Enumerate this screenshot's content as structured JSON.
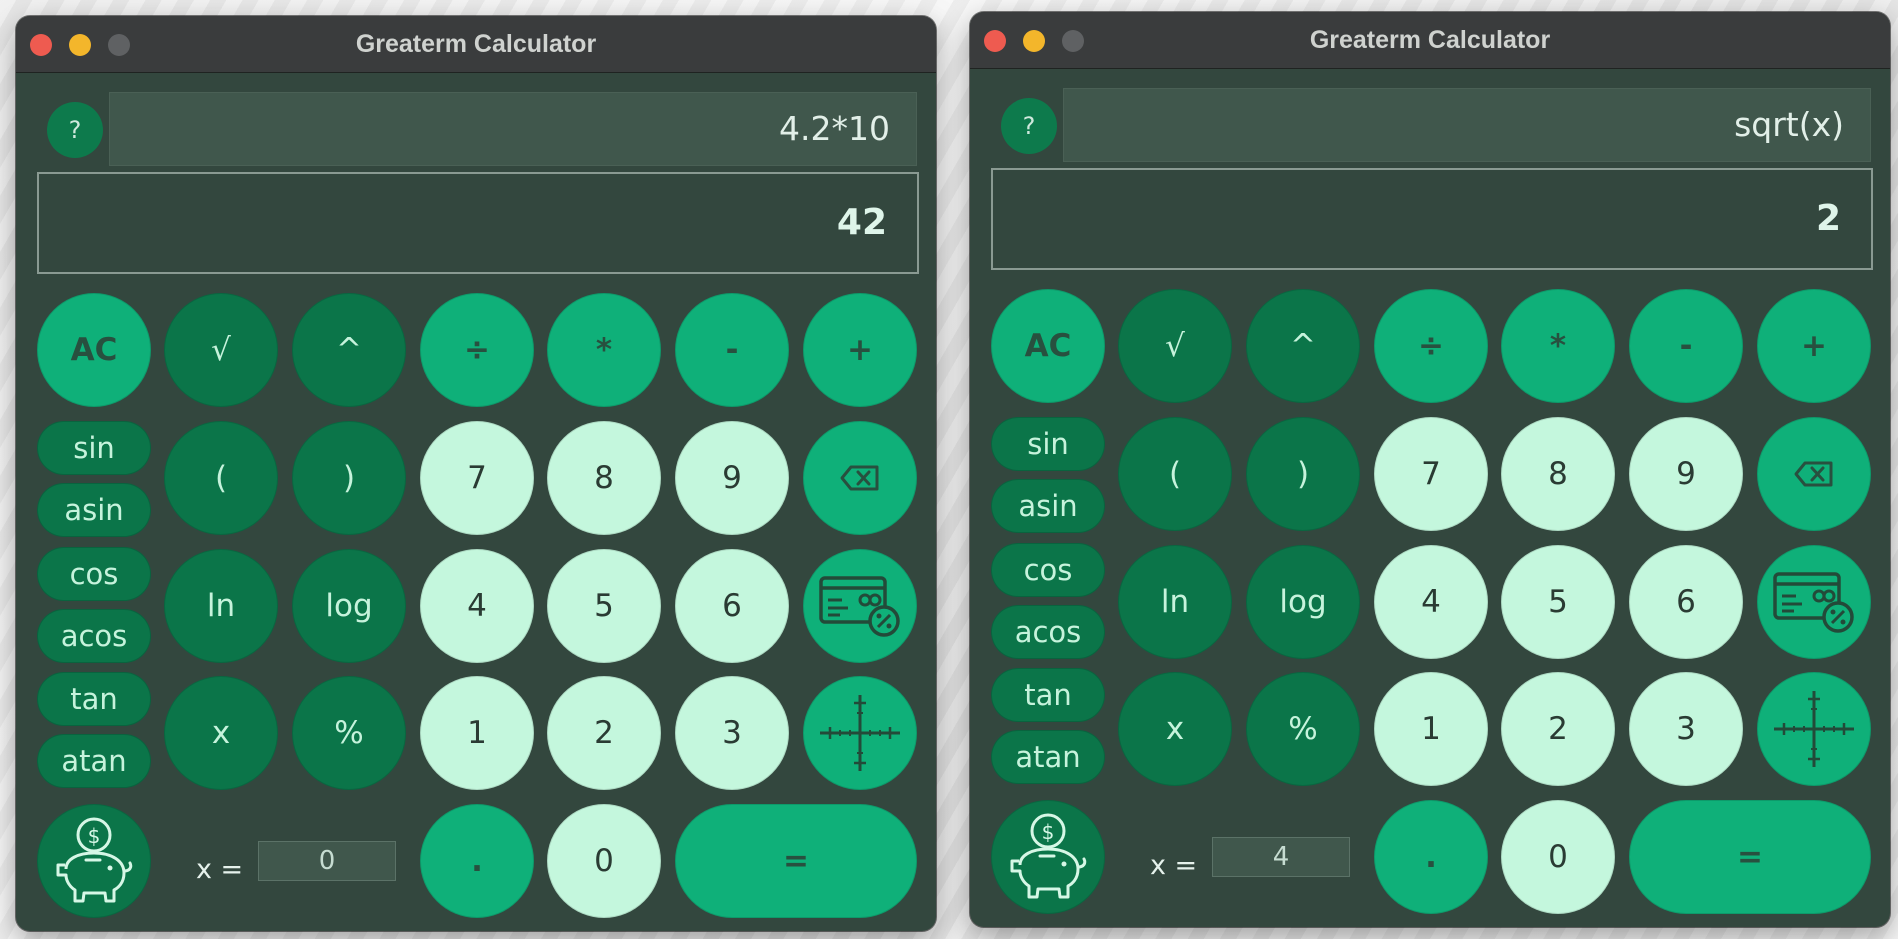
{
  "windows": [
    {
      "title": "Greaterm Calculator",
      "help_label": "?",
      "expression": "4.2*10",
      "result": "42",
      "x_label": "x =",
      "x_value": "0"
    },
    {
      "title": "Greaterm Calculator",
      "help_label": "?",
      "expression": "sqrt(x)",
      "result": "2",
      "x_label": "x =",
      "x_value": "4"
    }
  ],
  "keys": {
    "ac": "AC",
    "sqrt": "√",
    "pow": "^",
    "div": "÷",
    "mul": "*",
    "sub": "-",
    "add": "+",
    "lparen": "(",
    "rparen": ")",
    "seven": "7",
    "eight": "8",
    "nine": "9",
    "ln": "ln",
    "log": "log",
    "four": "4",
    "five": "5",
    "six": "6",
    "var_x": "x",
    "percent": "%",
    "one": "1",
    "two": "2",
    "three": "3",
    "dot": ".",
    "zero": "0",
    "equals": "="
  },
  "trig": [
    "sin",
    "asin",
    "cos",
    "acos",
    "tan",
    "atan"
  ],
  "icons": {
    "backspace": "backspace-icon",
    "finance": "card-percent-icon",
    "graph": "axes-icon",
    "savings": "piggy-bank-icon"
  },
  "colors": {
    "window_bg": "#33473e",
    "light_key": "#c4f7dd",
    "mid_key": "#0fb079",
    "dark_key": "#0b7549"
  }
}
